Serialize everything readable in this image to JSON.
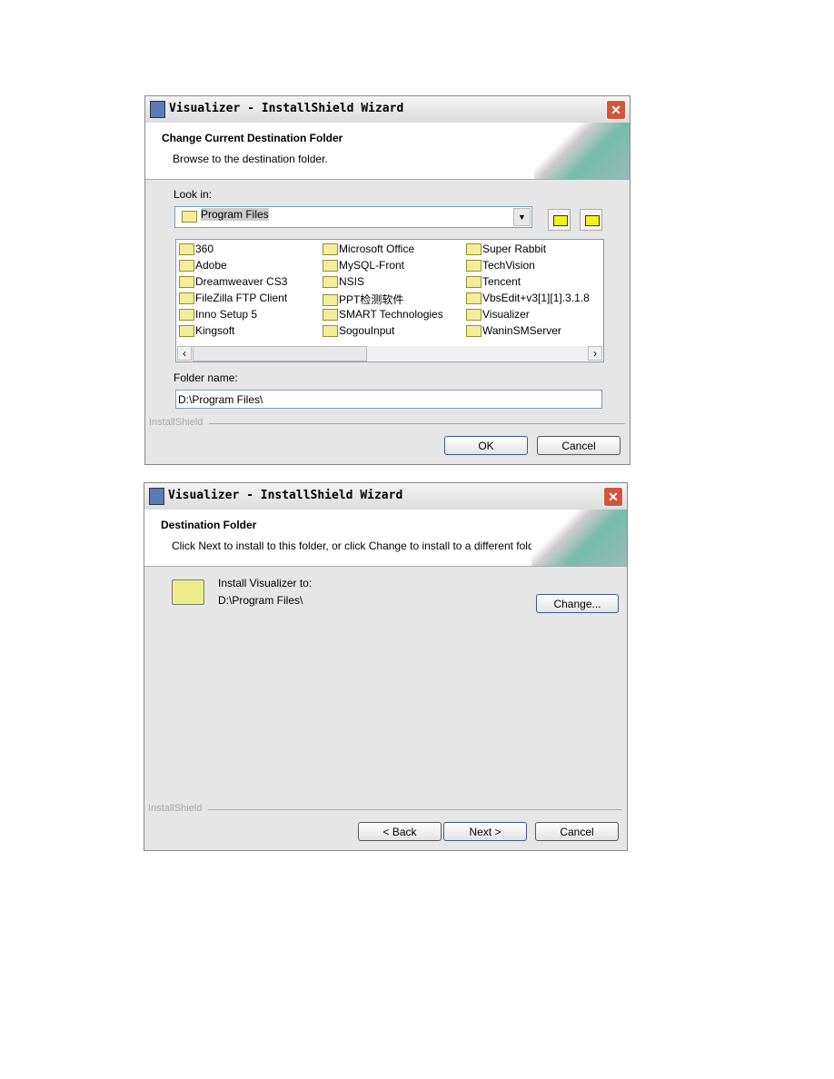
{
  "dialog1": {
    "title": "Visualizer - InstallShield Wizard",
    "heading": "Change Current Destination Folder",
    "subheading": "Browse to the destination folder.",
    "look_in_label": "Look in:",
    "look_in_value": "Program Files",
    "folders": [
      "360",
      "Adobe",
      "Dreamweaver CS3",
      "FileZilla FTP Client",
      "Inno Setup 5",
      "Kingsoft",
      "Microsoft Office",
      "MySQL-Front",
      "NSIS",
      "PPT检测软件",
      "SMART Technologies",
      "SogouInput",
      "Super Rabbit",
      "TechVision",
      "Tencent",
      "VbsEdit+v3[1][1].3.1.8",
      "Visualizer",
      "WaninSMServer"
    ],
    "folder_name_label": "Folder name:",
    "folder_name_value": "D:\\Program Files\\",
    "brand": "InstallShield",
    "ok": "OK",
    "cancel": "Cancel"
  },
  "dialog2": {
    "title": "Visualizer - InstallShield Wizard",
    "heading": "Destination Folder",
    "subheading": "Click Next to install to this folder, or click Change to install to a different folder.",
    "install_label": "Install Visualizer to:",
    "install_path": "D:\\Program Files\\",
    "change": "Change...",
    "brand": "InstallShield",
    "back": "< Back",
    "next": "Next >",
    "cancel": "Cancel"
  }
}
